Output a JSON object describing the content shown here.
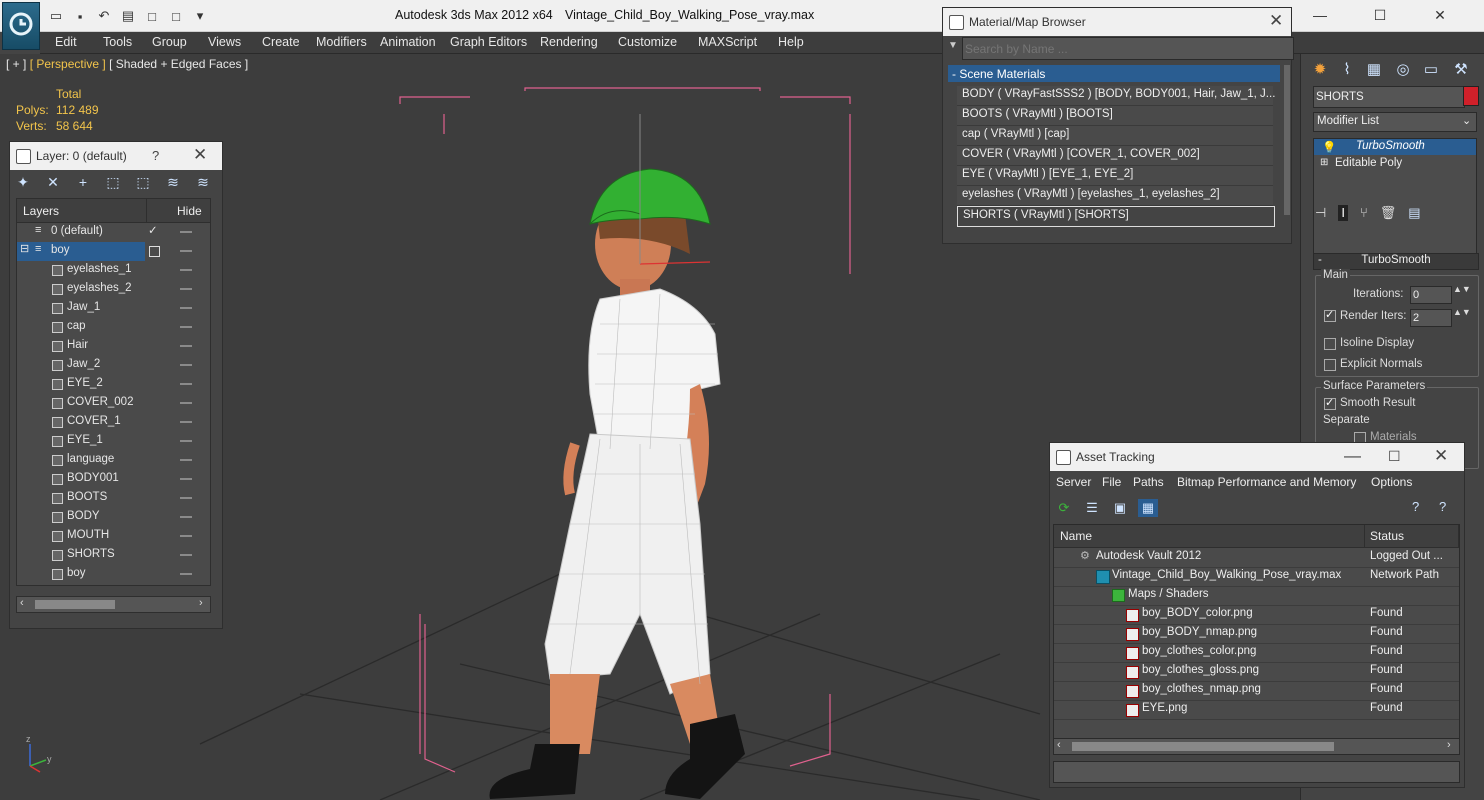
{
  "app": {
    "title": "Autodesk 3ds Max  2012 x64",
    "filename": "Vintage_Child_Boy_Walking_Pose_vray.max"
  },
  "menu": [
    "Edit",
    "Tools",
    "Group",
    "Views",
    "Create",
    "Modifiers",
    "Animation",
    "Graph Editors",
    "Rendering",
    "Customize",
    "MAXScript",
    "Help"
  ],
  "viewport": {
    "label_plus": "[ + ]",
    "label_view": "[ Perspective ]",
    "label_shading": "[ Shaded + Edged Faces ]",
    "stats_total": "Total",
    "stats_polys_label": "Polys:",
    "stats_polys": "112 489",
    "stats_verts_label": "Verts:",
    "stats_verts": "58 644"
  },
  "layers": {
    "title": "Layer: 0 (default)",
    "help": "?",
    "col_layers": "Layers",
    "col_hide": "Hide",
    "default_layer": "0 (default)",
    "group": "boy",
    "objects": [
      "eyelashes_1",
      "eyelashes_2",
      "Jaw_1",
      "cap",
      "Hair",
      "Jaw_2",
      "EYE_2",
      "COVER_002",
      "COVER_1",
      "EYE_1",
      "language",
      "BODY001",
      "BOOTS",
      "BODY",
      "MOUTH",
      "SHORTS",
      "boy"
    ]
  },
  "material_browser": {
    "title": "Material/Map Browser",
    "search_placeholder": "Search by Name ...",
    "section": "- Scene Materials",
    "rows": [
      "BODY  ( VRayFastSSS2 ) [BODY, BODY001, Hair, Jaw_1, J...",
      "BOOTS ( VRayMtl ) [BOOTS]",
      "cap ( VRayMtl ) [cap]",
      "COVER ( VRayMtl ) [COVER_1, COVER_002]",
      "EYE ( VRayMtl ) [EYE_1, EYE_2]",
      "eyelashes ( VRayMtl ) [eyelashes_1, eyelashes_2]",
      "SHORTS ( VRayMtl ) [SHORTS]"
    ]
  },
  "command_panel": {
    "object_name": "SHORTS",
    "modifier_list": "Modifier List",
    "stack": [
      "TurboSmooth",
      "Editable Poly"
    ],
    "rollout": "TurboSmooth",
    "main_group": "Main",
    "iterations_label": "Iterations:",
    "iterations": "0",
    "render_iters_label": "Render Iters:",
    "render_iters": "2",
    "isoline": "Isoline Display",
    "explicit_normals": "Explicit Normals",
    "surface_group": "Surface Parameters",
    "smooth_result": "Smooth Result",
    "separate": "Separate",
    "materials": "Materials"
  },
  "asset_tracking": {
    "title": "Asset Tracking",
    "menu": [
      "Server",
      "File",
      "Paths",
      "Bitmap Performance and Memory",
      "Options"
    ],
    "col_name": "Name",
    "col_status": "Status",
    "rows": [
      {
        "name": "Autodesk Vault 2012",
        "status": "Logged Out ..."
      },
      {
        "name": "Vintage_Child_Boy_Walking_Pose_vray.max",
        "status": "Network Path"
      },
      {
        "name": "Maps / Shaders",
        "status": ""
      },
      {
        "name": "boy_BODY_color.png",
        "status": "Found"
      },
      {
        "name": "boy_BODY_nmap.png",
        "status": "Found"
      },
      {
        "name": "boy_clothes_color.png",
        "status": "Found"
      },
      {
        "name": "boy_clothes_gloss.png",
        "status": "Found"
      },
      {
        "name": "boy_clothes_nmap.png",
        "status": "Found"
      },
      {
        "name": "EYE.png",
        "status": "Found"
      }
    ]
  },
  "colors": {
    "accent": "#2a5d91",
    "stats": "#f2c44b",
    "object_color": "#d0202a",
    "cap_wire": "#3bbf3b",
    "skin": "#d9825a"
  }
}
